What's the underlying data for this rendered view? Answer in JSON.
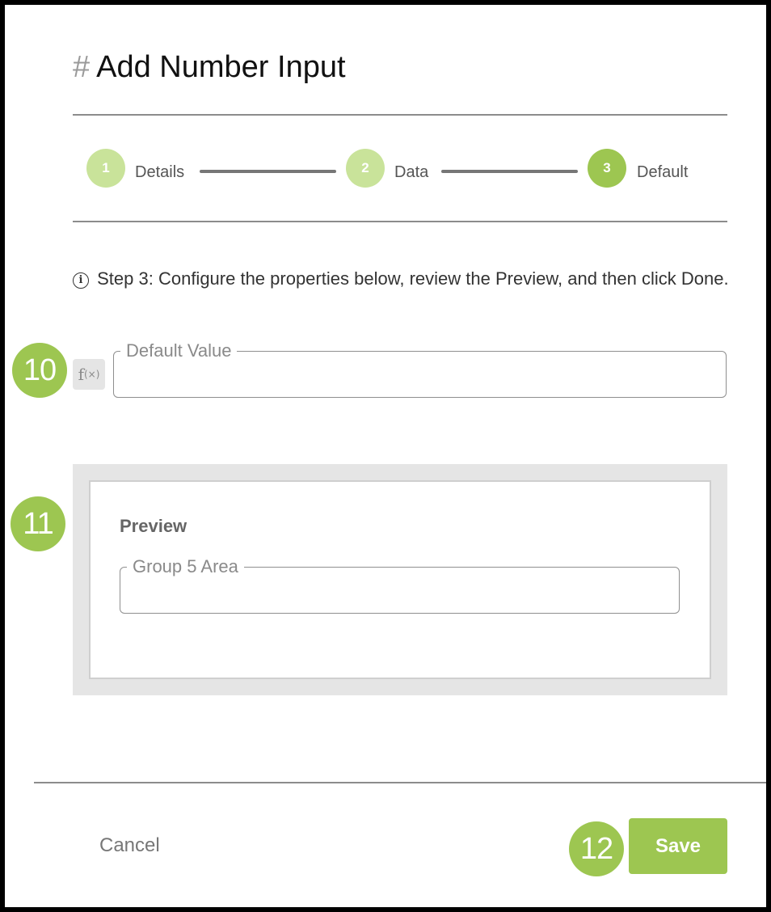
{
  "dialog": {
    "title_icon": "#",
    "title": "Add Number Input"
  },
  "stepper": {
    "steps": [
      {
        "number": "1",
        "label": "Details",
        "state": "completed"
      },
      {
        "number": "2",
        "label": "Data",
        "state": "completed"
      },
      {
        "number": "3",
        "label": "Default",
        "state": "active"
      }
    ],
    "colors": {
      "completed": "#c9e39a",
      "active": "#9dc651"
    }
  },
  "info": {
    "icon": "info-icon",
    "text": "Step 3: Configure the properties below, review the Preview, and then click Done."
  },
  "default_value": {
    "fx_icon": "function-icon",
    "fx_text": "f",
    "fx_sub": "(×)",
    "label": "Default Value",
    "value": ""
  },
  "preview": {
    "title": "Preview",
    "field_label": "Group 5 Area",
    "field_value": ""
  },
  "callouts": [
    "10",
    "11",
    "12"
  ],
  "footer": {
    "cancel_label": "Cancel",
    "save_label": "Save"
  },
  "accent_color": "#9dc651"
}
